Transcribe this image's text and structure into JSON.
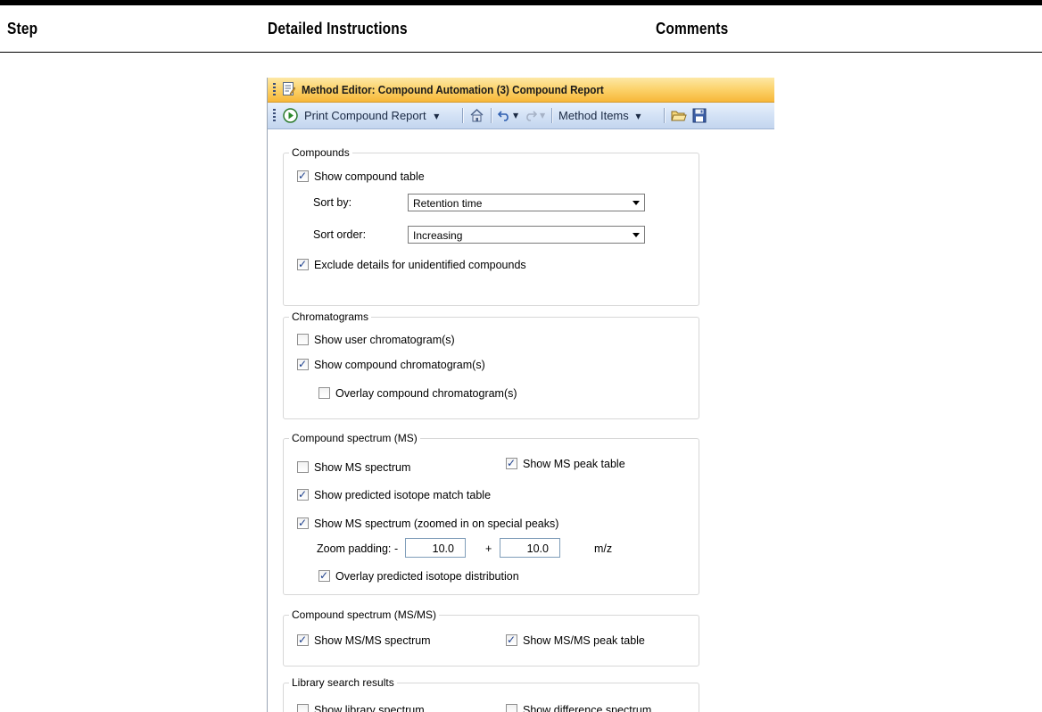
{
  "header": {
    "step": "Step",
    "instructions": "Detailed Instructions",
    "comments": "Comments"
  },
  "window": {
    "title": "Method Editor: Compound Automation (3) Compound Report",
    "toolbar": {
      "run_label": "Print Compound Report",
      "method_items_label": "Method Items"
    }
  },
  "compounds": {
    "label": "Compounds",
    "show_table": {
      "label": "Show compound table",
      "checked": true
    },
    "sort_by": {
      "label": "Sort by:",
      "value": "Retention time"
    },
    "sort_order": {
      "label": "Sort order:",
      "value": "Increasing"
    },
    "exclude": {
      "label": "Exclude details for unidentified compounds",
      "checked": true
    }
  },
  "chromatograms": {
    "label": "Chromatograms",
    "user": {
      "label": "Show user chromatogram(s)",
      "checked": false
    },
    "compound": {
      "label": "Show compound chromatogram(s)",
      "checked": true
    },
    "overlay": {
      "label": "Overlay compound chromatogram(s)",
      "checked": false
    }
  },
  "ms": {
    "label": "Compound spectrum (MS)",
    "spectrum": {
      "label": "Show MS spectrum",
      "checked": false
    },
    "peak_table": {
      "label": "Show MS peak table",
      "checked": true
    },
    "isotope_table": {
      "label": "Show predicted isotope match table",
      "checked": true
    },
    "zoomed": {
      "label": "Show MS spectrum (zoomed in on special peaks)",
      "checked": true
    },
    "zoom_label": "Zoom padding:",
    "minus": "-",
    "plus": "+",
    "zoom_minus": "10.0",
    "zoom_plus": "10.0",
    "unit": "m/z",
    "overlay": {
      "label": "Overlay predicted isotope distribution",
      "checked": true
    }
  },
  "msms": {
    "label": "Compound spectrum (MS/MS)",
    "spectrum": {
      "label": "Show MS/MS spectrum",
      "checked": true
    },
    "peak_table": {
      "label": "Show MS/MS peak table",
      "checked": true
    }
  },
  "library": {
    "label": "Library search results",
    "library_spectrum": {
      "label": "Show library spectrum",
      "checked": false
    },
    "difference": {
      "label": "Show difference spectrum",
      "checked": false
    }
  },
  "colors": {
    "titlebar": "#f7b739",
    "toolbar": "#d2e1f5",
    "check": "#1d3f8c"
  }
}
